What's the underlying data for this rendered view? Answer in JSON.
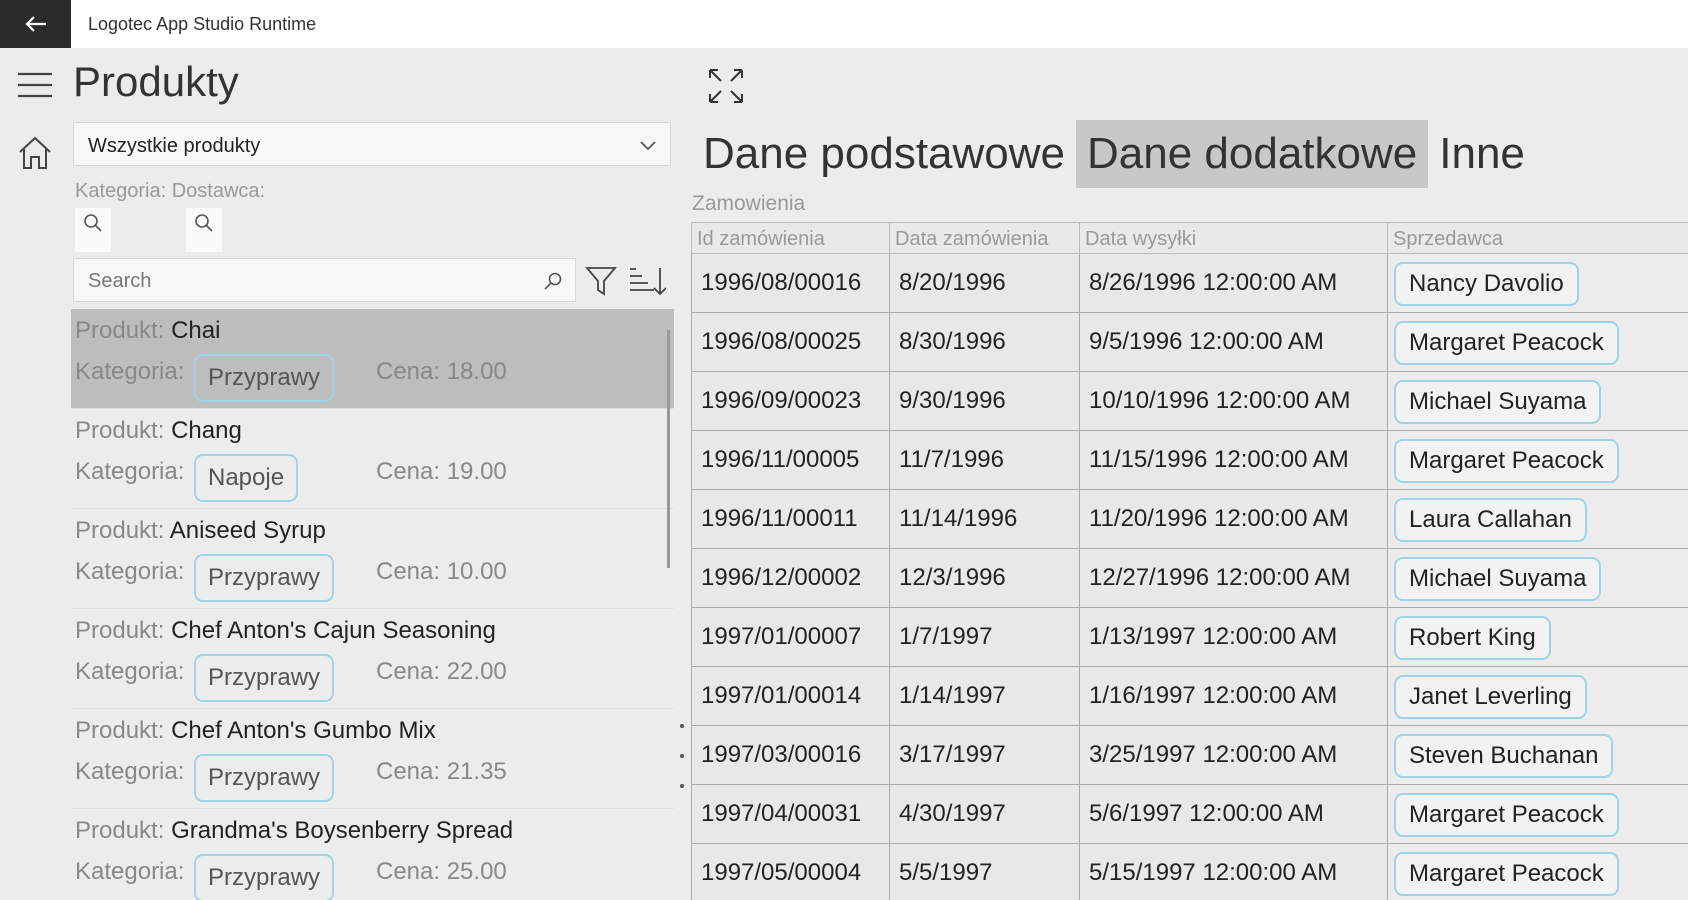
{
  "window": {
    "title": "Logotec App Studio Runtime"
  },
  "page": {
    "title": "Produkty"
  },
  "filter": {
    "dropdown_value": "Wszystkie produkty",
    "label_category": "Kategoria:",
    "label_supplier": "Dostawca:",
    "search_placeholder": "Search"
  },
  "products": [
    {
      "product_label": "Produkt:",
      "name": "Chai",
      "category_label": "Kategoria:",
      "category": "Przyprawy",
      "price": "Cena: 18.00",
      "selected": true
    },
    {
      "product_label": "Produkt:",
      "name": "Chang",
      "category_label": "Kategoria:",
      "category": "Napoje",
      "price": "Cena: 19.00",
      "selected": false
    },
    {
      "product_label": "Produkt:",
      "name": "Aniseed Syrup",
      "category_label": "Kategoria:",
      "category": "Przyprawy",
      "price": "Cena: 10.00",
      "selected": false
    },
    {
      "product_label": "Produkt:",
      "name": "Chef Anton's Cajun Seasoning",
      "category_label": "Kategoria:",
      "category": "Przyprawy",
      "price": "Cena: 22.00",
      "selected": false
    },
    {
      "product_label": "Produkt:",
      "name": "Chef Anton's Gumbo Mix",
      "category_label": "Kategoria:",
      "category": "Przyprawy",
      "price": "Cena: 21.35",
      "selected": false
    },
    {
      "product_label": "Produkt:",
      "name": "Grandma's Boysenberry Spread",
      "category_label": "Kategoria:",
      "category": "Przyprawy",
      "price": "Cena: 25.00",
      "selected": false
    }
  ],
  "detail": {
    "tabs": [
      "Dane podstawowe",
      "Dane dodatkowe",
      "Inne"
    ],
    "active_tab": 1,
    "grid_label": "Zamowienia",
    "columns": [
      "Id zamówienia",
      "Data zamówienia",
      "Data wysyłki",
      "Sprzedawca"
    ],
    "rows": [
      [
        "1996/08/00016",
        "8/20/1996",
        "8/26/1996 12:00:00 AM",
        "Nancy  Davolio"
      ],
      [
        "1996/08/00025",
        "8/30/1996",
        "9/5/1996 12:00:00 AM",
        "Margaret  Peacock"
      ],
      [
        "1996/09/00023",
        "9/30/1996",
        "10/10/1996 12:00:00 AM",
        "Michael  Suyama"
      ],
      [
        "1996/11/00005",
        "11/7/1996",
        "11/15/1996 12:00:00 AM",
        "Margaret  Peacock"
      ],
      [
        "1996/11/00011",
        "11/14/1996",
        "11/20/1996 12:00:00 AM",
        "Laura  Callahan"
      ],
      [
        "1996/12/00002",
        "12/3/1996",
        "12/27/1996 12:00:00 AM",
        "Michael  Suyama"
      ],
      [
        "1997/01/00007",
        "1/7/1997",
        "1/13/1997 12:00:00 AM",
        "Robert  King"
      ],
      [
        "1997/01/00014",
        "1/14/1997",
        "1/16/1997 12:00:00 AM",
        "Janet  Leverling"
      ],
      [
        "1997/03/00016",
        "3/17/1997",
        "3/25/1997 12:00:00 AM",
        "Steven  Buchanan"
      ],
      [
        "1997/04/00031",
        "4/30/1997",
        "5/6/1997 12:00:00 AM",
        "Margaret  Peacock"
      ],
      [
        "1997/05/00004",
        "5/5/1997",
        "5/15/1997 12:00:00 AM",
        "Margaret  Peacock"
      ]
    ]
  },
  "icons": {
    "back": "back-arrow-icon",
    "menu": "hamburger-menu-icon",
    "home": "home-icon",
    "dropdown": "chevron-down-icon",
    "filter_search": "search-icon",
    "filter": "filter-icon",
    "sort": "sort-icon",
    "expand": "expand-icon"
  },
  "colors": {
    "accent_border": "#9fd3e5",
    "selected_row": "#bdbdbd",
    "active_tab": "#c8c8c8",
    "titlebar_back": "#2b2b2b"
  }
}
